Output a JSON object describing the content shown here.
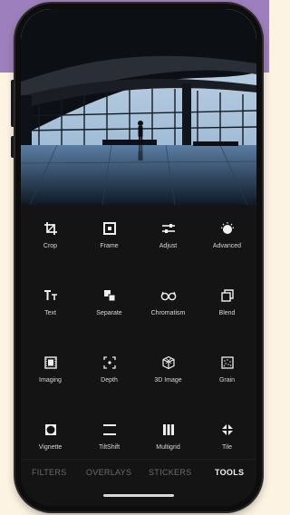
{
  "tools": [
    {
      "label": "Crop",
      "icon": "crop-icon"
    },
    {
      "label": "Frame",
      "icon": "frame-icon"
    },
    {
      "label": "Adjust",
      "icon": "sliders-icon"
    },
    {
      "label": "Advanced",
      "icon": "advanced-dial-icon"
    },
    {
      "label": "Text",
      "icon": "text-icon"
    },
    {
      "label": "Separate",
      "icon": "separate-layers-icon"
    },
    {
      "label": "Chromatism",
      "icon": "glasses-icon"
    },
    {
      "label": "Blend",
      "icon": "blend-icon"
    },
    {
      "label": "Imaging",
      "icon": "film-icon"
    },
    {
      "label": "Depth",
      "icon": "depth-icon"
    },
    {
      "label": "3D Image",
      "icon": "cube-3d-icon"
    },
    {
      "label": "Grain",
      "icon": "grain-icon"
    },
    {
      "label": "Vignette",
      "icon": "vignette-icon"
    },
    {
      "label": "TiltShift",
      "icon": "tiltshift-icon"
    },
    {
      "label": "Multigrid",
      "icon": "multigrid-icon"
    },
    {
      "label": "Tile",
      "icon": "tile-icon"
    }
  ],
  "tabs": [
    {
      "label": "FILTERS",
      "active": false
    },
    {
      "label": "OVERLAYS",
      "active": false
    },
    {
      "label": "STICKERS",
      "active": false
    },
    {
      "label": "TOOLS",
      "active": true
    }
  ],
  "colors": {
    "page_background": "#fdf3e3",
    "accent_band": "#9e7fbd",
    "panel": "#141414",
    "active_tab": "#f2f2f2",
    "inactive_tab": "#6b6b6b"
  }
}
